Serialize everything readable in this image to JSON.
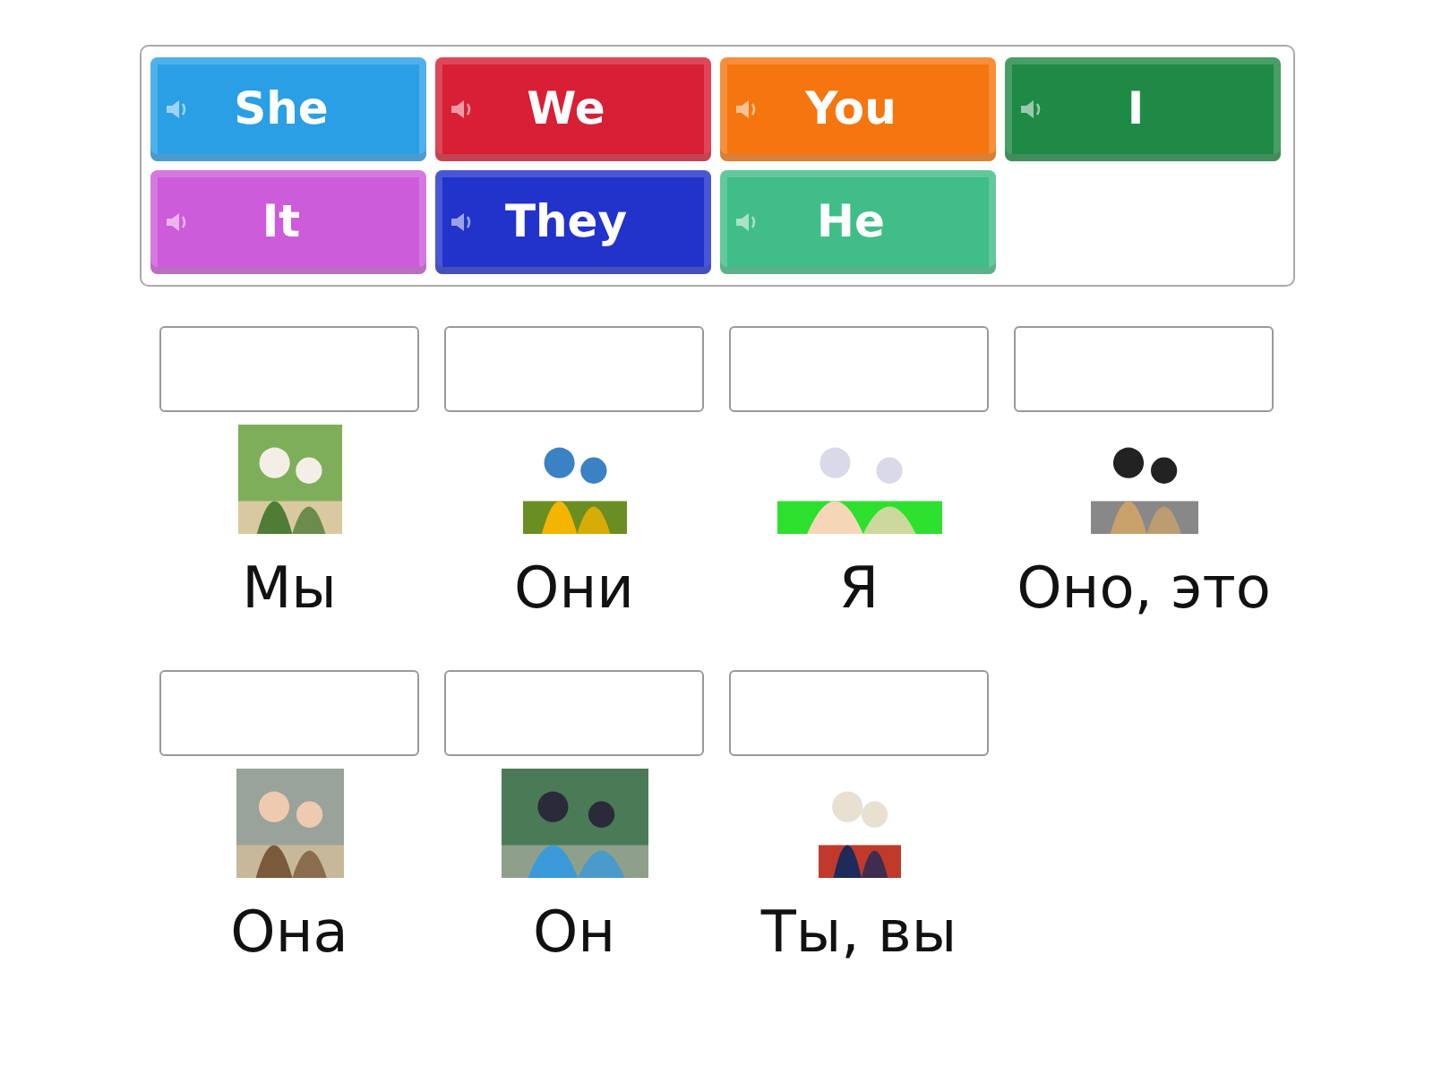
{
  "tiles": [
    {
      "label": "She",
      "color": "#2a9fe6"
    },
    {
      "label": "We",
      "color": "#d81f35"
    },
    {
      "label": "You",
      "color": "#f5760f"
    },
    {
      "label": "I",
      "color": "#1f8a45"
    },
    {
      "label": "It",
      "color": "#cc5cd9"
    },
    {
      "label": "They",
      "color": "#2233cc"
    },
    {
      "label": "He",
      "color": "#40bd88"
    }
  ],
  "targets": [
    {
      "label": "Мы"
    },
    {
      "label": "Они"
    },
    {
      "label": "Я"
    },
    {
      "label": "Оно, это"
    },
    {
      "label": "Она"
    },
    {
      "label": "Он"
    },
    {
      "label": "Ты, вы"
    }
  ]
}
